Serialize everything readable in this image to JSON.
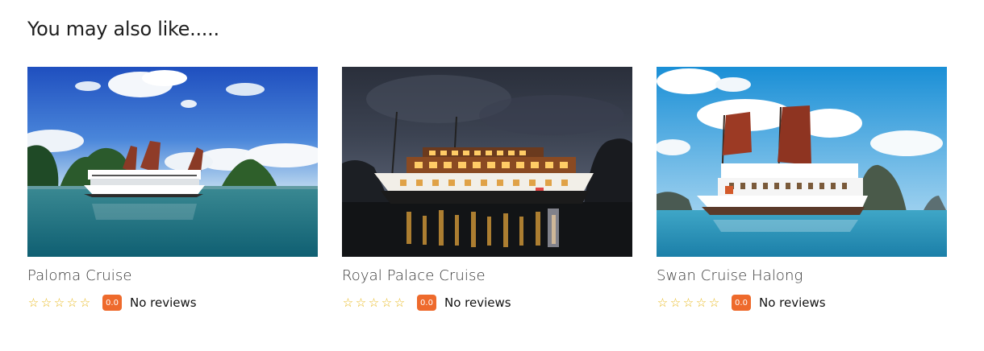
{
  "section": {
    "heading": "You may also like....."
  },
  "cards": [
    {
      "title": "Paloma Cruise",
      "image_description_icon": "photo-boat-icon",
      "rating_stars_filled": 0,
      "rating_stars_total": 5,
      "score": "0.0",
      "reviews_text": "No reviews"
    },
    {
      "title": "Royal Palace Cruise",
      "image_description_icon": "photo-boat-night-icon",
      "rating_stars_filled": 0,
      "rating_stars_total": 5,
      "score": "0.0",
      "reviews_text": "No reviews"
    },
    {
      "title": "Swan Cruise Halong",
      "image_description_icon": "photo-boat-icon",
      "rating_stars_filled": 0,
      "rating_stars_total": 5,
      "score": "0.0",
      "reviews_text": "No reviews"
    }
  ],
  "colors": {
    "star": "#e8b719",
    "badge": "#ee6a2c"
  }
}
